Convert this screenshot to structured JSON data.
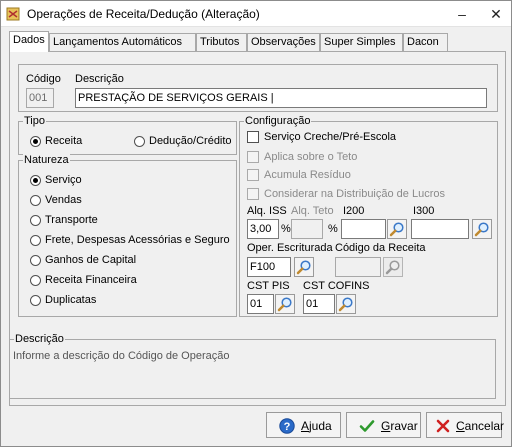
{
  "window": {
    "title": "Operações de Receita/Dedução (Alteração)",
    "minimize_glyph": "–",
    "maximize_glyph": "☐",
    "close_glyph": "✕"
  },
  "tabs": [
    {
      "label": "Dados",
      "active": true
    },
    {
      "label": "Lançamentos Automáticos",
      "active": false
    },
    {
      "label": "Tributos",
      "active": false
    },
    {
      "label": "Observações",
      "active": false
    },
    {
      "label": "Super Simples",
      "active": false
    },
    {
      "label": "Dacon",
      "active": false
    }
  ],
  "header": {
    "codigo_label": "Código",
    "codigo_value": "001",
    "descricao_label": "Descrição",
    "descricao_value": "PRESTAÇÃO DE SERVIÇOS GERAIS |"
  },
  "tipo": {
    "title": "Tipo",
    "options": [
      {
        "label": "Receita",
        "checked": true
      },
      {
        "label": "Dedução/Crédito",
        "checked": false
      }
    ]
  },
  "natureza": {
    "title": "Natureza",
    "options": [
      {
        "label": "Serviço",
        "checked": true
      },
      {
        "label": "Vendas",
        "checked": false
      },
      {
        "label": "Transporte",
        "checked": false
      },
      {
        "label": "Frete, Despesas Acessórias e Seguro",
        "checked": false
      },
      {
        "label": "Ganhos de Capital",
        "checked": false
      },
      {
        "label": "Receita Financeira",
        "checked": false
      },
      {
        "label": "Duplicatas",
        "checked": false
      }
    ]
  },
  "configuracao": {
    "title": "Configuração",
    "checkboxes": [
      {
        "label": "Serviço Creche/Pré-Escola",
        "checked": false,
        "enabled": true
      },
      {
        "label": "Aplica sobre o Teto",
        "checked": false,
        "enabled": false
      },
      {
        "label": "Acumula Resíduo",
        "checked": false,
        "enabled": false
      },
      {
        "label": "Considerar na Distribuição de Lucros",
        "checked": false,
        "enabled": false
      }
    ],
    "aliq_iss_label": "Alq. ISS",
    "aliq_iss_value": "3,00",
    "aliq_iss_unit": "%",
    "aliq_teto_label": "Alq. Teto",
    "aliq_teto_value": "",
    "aliq_teto_unit": "%",
    "i200_label": "I200",
    "i200_value": "",
    "i300_label": "I300",
    "i300_value": "",
    "oper_escrit_label": "Oper. Escriturada",
    "oper_escrit_value": "F100",
    "codigo_receita_label": "Código da Receita",
    "codigo_receita_value": "",
    "cst_pis_label": "CST PIS",
    "cst_pis_value": "01",
    "cst_cofins_label": "CST COFINS",
    "cst_cofins_value": "01"
  },
  "descricao_panel": {
    "title": "Descrição",
    "text": "Informe a descrição do Código de Operação"
  },
  "buttons": {
    "ajuda_first": "A",
    "ajuda_rest": "juda",
    "gravar_first": "G",
    "gravar_rest": "ravar",
    "cancelar_first": "C",
    "cancelar_rest": "ancelar"
  },
  "colors": {
    "help_icon": "#2a6ac8",
    "gravar_icon": "#2e9a2e",
    "cancel_icon": "#d02020",
    "tab_border": "#a8a8a8"
  }
}
